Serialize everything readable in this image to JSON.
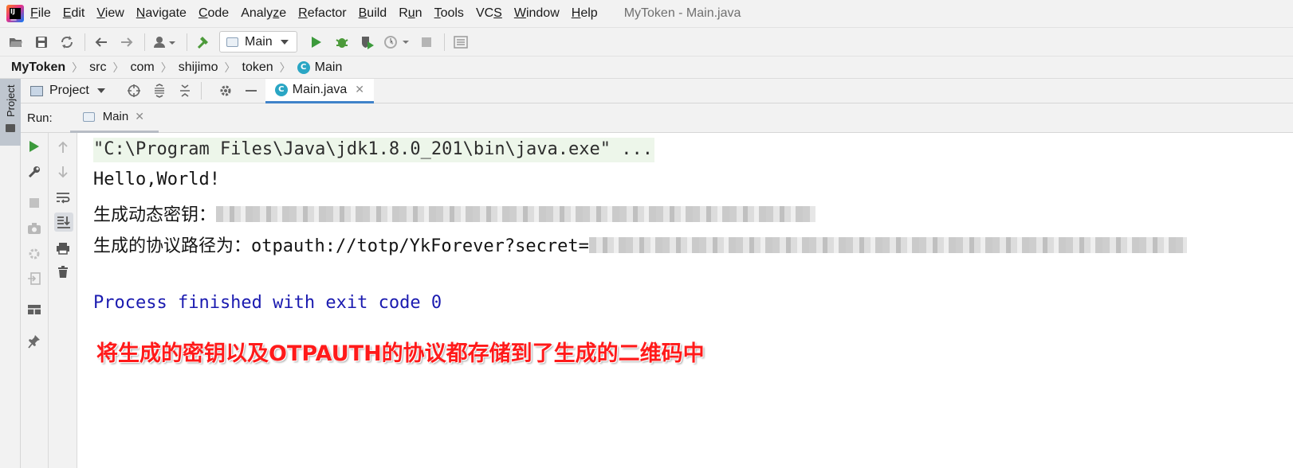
{
  "window": {
    "title": "MyToken - Main.java"
  },
  "menu": [
    {
      "label": "File",
      "mnemonic": "F",
      "rest": "ile"
    },
    {
      "label": "Edit",
      "mnemonic": "E",
      "rest": "dit"
    },
    {
      "label": "View",
      "mnemonic": "V",
      "rest": "iew"
    },
    {
      "label": "Navigate",
      "mnemonic": "N",
      "rest": "avigate"
    },
    {
      "label": "Code",
      "mnemonic": "C",
      "rest": "ode"
    },
    {
      "label": "Analyze",
      "pre": "Analy",
      "mnemonic": "z",
      "rest": "e"
    },
    {
      "label": "Refactor",
      "mnemonic": "R",
      "rest": "efactor"
    },
    {
      "label": "Build",
      "mnemonic": "B",
      "rest": "uild"
    },
    {
      "label": "Run",
      "pre": "R",
      "mnemonic": "u",
      "rest": "n"
    },
    {
      "label": "Tools",
      "mnemonic": "T",
      "rest": "ools"
    },
    {
      "label": "VCS",
      "pre": "VC",
      "mnemonic": "S",
      "rest": ""
    },
    {
      "label": "Window",
      "mnemonic": "W",
      "rest": "indow"
    },
    {
      "label": "Help",
      "mnemonic": "H",
      "rest": "elp"
    }
  ],
  "toolbar": {
    "run_config": "Main",
    "icons": [
      "open-folder-icon",
      "save-icon",
      "sync-icon",
      "back-icon",
      "forward-icon",
      "user-icon",
      "build-hammer-icon",
      "run-icon",
      "debug-icon",
      "coverage-icon",
      "profile-icon",
      "stop-icon",
      "structure-icon"
    ],
    "colors": {
      "run": "#3c9a3c",
      "build": "#4c9a3a"
    }
  },
  "breadcrumb": [
    "MyToken",
    "src",
    "com",
    "shijimo",
    "token",
    "Main"
  ],
  "project_panel": {
    "title": "Project",
    "stripe_label": "Project"
  },
  "editor_tabs": [
    {
      "label": "Main.java",
      "active": true
    }
  ],
  "run_panel": {
    "label": "Run:",
    "tab": "Main"
  },
  "console": {
    "command": "\"C:\\Program Files\\Java\\jdk1.8.0_201\\bin\\java.exe\" ...",
    "lines": [
      "Hello,World!",
      "生成动态密钥：",
      "生成的协议路径为：otpauth://totp/YkForever?secret="
    ],
    "exit": "Process finished with exit code 0"
  },
  "annotation": "将生成的密钥以及OTPAUTH的协议都存储到了生成的二维码中",
  "colors": {
    "exit_text": "#1b1bb0",
    "annotation": "#ff1a1a",
    "tab_underline": "#4083c9",
    "cmd_bg": "#edf6ea"
  }
}
